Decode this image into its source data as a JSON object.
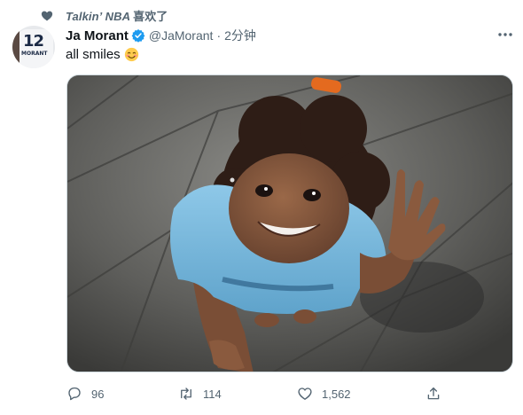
{
  "context": {
    "prefix": "Talkin’ NBA",
    "suffix": "喜欢了",
    "icon": "heart-icon"
  },
  "author": {
    "display_name": "Ja Morant",
    "handle": "@JaMorant",
    "separator": "·",
    "time": "2分钟",
    "verified": true,
    "avatar_jersey_number": "12",
    "avatar_jersey_name": "MORANT"
  },
  "tweet": {
    "text": "all smiles",
    "emoji": "smiling-face-emoji"
  },
  "actions": {
    "reply_count": "96",
    "retweet_count": "114",
    "like_count": "1,562",
    "share_icon": "share-icon"
  },
  "colors": {
    "verified": "#1d9bf0",
    "secondary_text": "#536471",
    "primary_text": "#0f1419"
  }
}
